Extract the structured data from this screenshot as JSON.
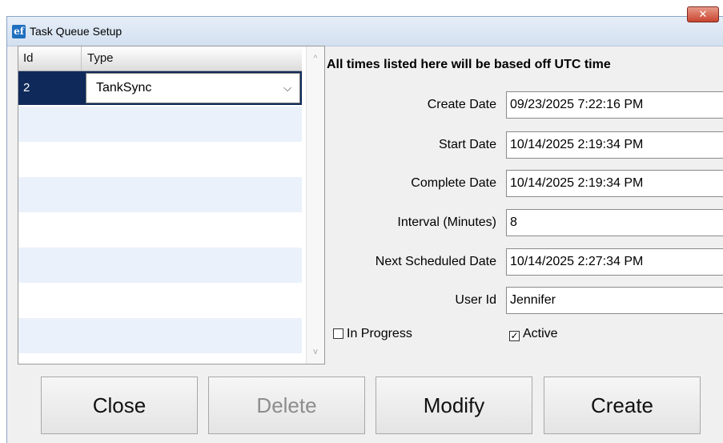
{
  "window": {
    "title": "Task Queue Setup",
    "app_icon": "ef",
    "close_glyph": "✕"
  },
  "grid": {
    "columns": [
      "Id",
      "Type"
    ],
    "rows": [
      {
        "id": "2",
        "type": "TankSync",
        "selected": true
      }
    ],
    "scroll_up_glyph": "^",
    "scroll_down_glyph": "v",
    "combo_arrow_glyph": "⌵"
  },
  "form": {
    "notice": "All times listed here will be based off UTC time",
    "fields": [
      {
        "label": "Create Date",
        "value": "09/23/2025 7:22:16 PM"
      },
      {
        "label": "Start Date",
        "value": "10/14/2025 2:19:34 PM"
      },
      {
        "label": "Complete Date",
        "value": "10/14/2025 2:19:34 PM"
      },
      {
        "label": "Interval (Minutes)",
        "value": "8"
      },
      {
        "label": "Next Scheduled Date",
        "value": "10/14/2025 2:27:34 PM"
      },
      {
        "label": "User Id",
        "value": "Jennifer"
      }
    ],
    "in_progress": {
      "label": "In Progress",
      "checked": false
    },
    "active": {
      "label": "Active",
      "checked": true,
      "check_glyph": "✓"
    }
  },
  "buttons": {
    "close": "Close",
    "delete": "Delete",
    "modify": "Modify",
    "create": "Create"
  },
  "colors": {
    "selected_row": "#0f2a5a",
    "alt_row": "#eaf1fb",
    "titlebar_close": "#c8452f"
  }
}
